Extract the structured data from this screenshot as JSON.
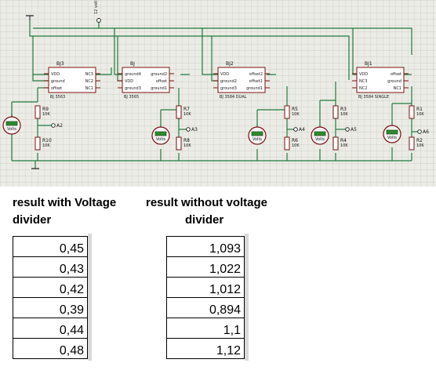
{
  "schematic": {
    "supply_label": "12 volt",
    "chips": [
      {
        "ref": "BJ3",
        "part": "BJ 3563",
        "pins_left": [
          "VDD",
          "ground",
          "offset"
        ],
        "pins_right": [
          "NC3",
          "NC2",
          "NC1"
        ]
      },
      {
        "ref": "BJ",
        "part": "BJ 3565",
        "pins_left": [
          "ground4",
          "VDD",
          "ground3"
        ],
        "pins_right": [
          "ground2",
          "offset",
          "ground1"
        ]
      },
      {
        "ref": "BJ2",
        "part": "BJ 3584 DUAL",
        "pins_left": [
          "VDD",
          "ground2",
          "ground3"
        ],
        "pins_right": [
          "offset2",
          "offset1",
          "ground1"
        ]
      },
      {
        "ref": "BJ1",
        "part": "BJ 3584 SINGLE",
        "pins_left": [
          "VDD",
          "NC3",
          "NC2"
        ],
        "pins_right": [
          "offset",
          "ground",
          "NC1"
        ]
      }
    ],
    "resistors": [
      {
        "ref": "R9",
        "value": "10K"
      },
      {
        "ref": "R10",
        "value": "10K"
      },
      {
        "ref": "R7",
        "value": "10K"
      },
      {
        "ref": "R8",
        "value": "10K"
      },
      {
        "ref": "R5",
        "value": "10K"
      },
      {
        "ref": "R6",
        "value": "10K"
      },
      {
        "ref": "R3",
        "value": "10K"
      },
      {
        "ref": "R4",
        "value": "10K"
      },
      {
        "ref": "R1",
        "value": "10K"
      },
      {
        "ref": "R2",
        "value": "10K"
      }
    ],
    "probes": [
      "A2",
      "A3",
      "A4",
      "A5",
      "A6"
    ],
    "meter_unit": "Volts"
  },
  "results_with_divider": {
    "heading_line1": "result with Voltage",
    "heading_line2": "divider",
    "values": [
      "0,45",
      "0,43",
      "0,42",
      "0,39",
      "0,44",
      "0,48"
    ]
  },
  "results_without_divider": {
    "heading_line1": "result  without voltage",
    "heading_line2": "divider",
    "values": [
      "1,093",
      "1,022",
      "1,012",
      "0,894",
      "1,1",
      "1,12"
    ]
  }
}
